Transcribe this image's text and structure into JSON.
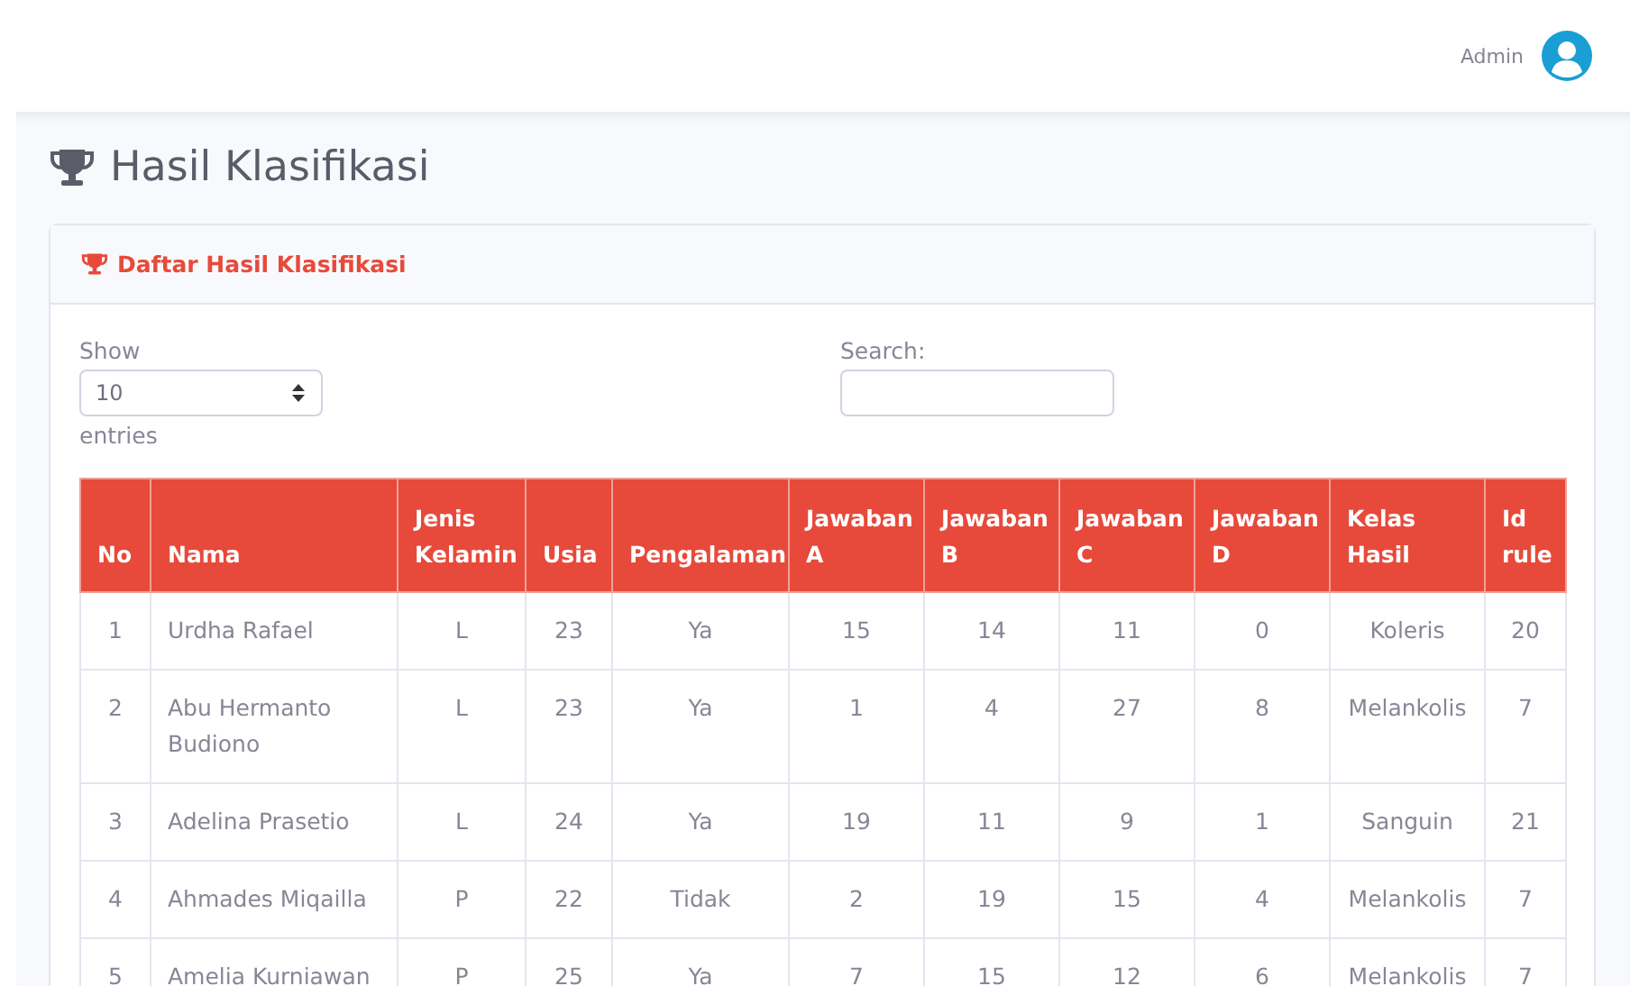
{
  "topbar": {
    "user_name": "Admin"
  },
  "page_title": "Hasil Klasifikasi",
  "card": {
    "title": "Daftar Hasil Klasifikasi",
    "length_control": {
      "label_before": "Show",
      "value": "10",
      "label_after": "entries"
    },
    "search": {
      "label": "Search:"
    },
    "table": {
      "columns": [
        "No",
        "Nama",
        "Jenis Kelamin",
        "Usia",
        "Pengalaman",
        "Jawaban A",
        "Jawaban B",
        "Jawaban C",
        "Jawaban D",
        "Kelas Hasil",
        "Id rule"
      ],
      "rows": [
        [
          "1",
          "Urdha Rafael",
          "L",
          "23",
          "Ya",
          "15",
          "14",
          "11",
          "0",
          "Koleris",
          "20"
        ],
        [
          "2",
          "Abu Hermanto Budiono",
          "L",
          "23",
          "Ya",
          "1",
          "4",
          "27",
          "8",
          "Melankolis",
          "7"
        ],
        [
          "3",
          "Adelina Prasetio",
          "L",
          "24",
          "Ya",
          "19",
          "11",
          "9",
          "1",
          "Sanguin",
          "21"
        ],
        [
          "4",
          "Ahmades Miqailla",
          "P",
          "22",
          "Tidak",
          "2",
          "19",
          "15",
          "4",
          "Melankolis",
          "7"
        ],
        [
          "5",
          "Amelia Kurniawan",
          "P",
          "25",
          "Ya",
          "7",
          "15",
          "12",
          "6",
          "Melankolis",
          "7"
        ]
      ]
    }
  }
}
